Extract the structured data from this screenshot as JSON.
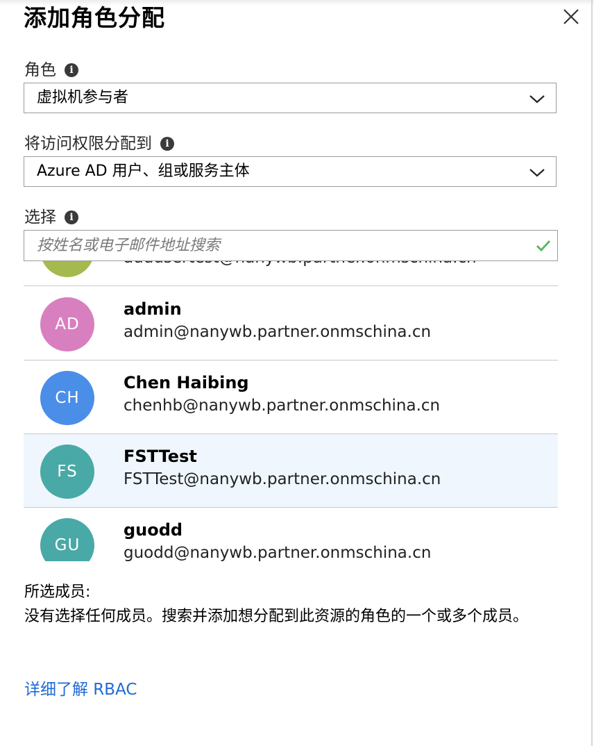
{
  "header": {
    "title": "添加角色分配"
  },
  "role": {
    "label": "角色",
    "value": "虚拟机参与者"
  },
  "assign_access": {
    "label": "将访问权限分配到",
    "value": "Azure AD 用户、组或服务主体"
  },
  "select": {
    "label": "选择",
    "placeholder": "按姓名或电子邮件地址搜索"
  },
  "users": [
    {
      "initials": "",
      "name": "",
      "email": "addusertest@nanywb.partner.onmschina.cn",
      "color": "#a4ba4e"
    },
    {
      "initials": "AD",
      "name": "admin",
      "email": "admin@nanywb.partner.onmschina.cn",
      "color": "#d87fbf"
    },
    {
      "initials": "CH",
      "name": "Chen Haibing",
      "email": "chenhb@nanywb.partner.onmschina.cn",
      "color": "#4a8ee8"
    },
    {
      "initials": "FS",
      "name": "FSTTest",
      "email": "FSTTest@nanywb.partner.onmschina.cn",
      "color": "#49a9a6"
    },
    {
      "initials": "GU",
      "name": "guodd",
      "email": "guodd@nanywb.partner.onmschina.cn",
      "color": "#49a9a6"
    }
  ],
  "members": {
    "title": "所选成员:",
    "description": "没有选择任何成员。搜索并添加想分配到此资源的角色的一个或多个成员。"
  },
  "learn_more": "详细了解 RBAC",
  "colors": {
    "accent_link": "#1f6ad6",
    "check_green": "#5cb85c",
    "selected_row": "#eff6fd"
  }
}
